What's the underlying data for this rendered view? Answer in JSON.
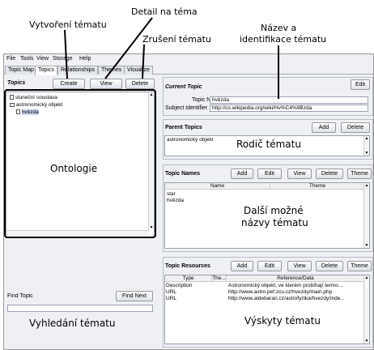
{
  "annotations": {
    "detail": "Detail na téma",
    "create": "Vytvoření tématu",
    "delete": "Zrušení tématu",
    "name_line1": "Název a",
    "name_line2": "identifikace tématu",
    "parent": "Rodič tématu",
    "ontology": "Ontologie",
    "names_line1": "Další možné",
    "names_line2": "názvy tématu",
    "find": "Vyhledání tématu",
    "resources": "Výskyty tématu"
  },
  "menu": [
    "File",
    "Tools",
    "View",
    "Storage",
    "Help"
  ],
  "tabs": [
    "Topic Map",
    "Topics",
    "Relationships",
    "Themes",
    "Visualize"
  ],
  "topics_panel": {
    "title": "Topics",
    "create": "Create",
    "view": "View",
    "delete": "Delete",
    "tree": [
      "sluneční soustava",
      "astronomický objekt",
      "hvězda"
    ]
  },
  "find": {
    "label": "Find Topic",
    "button": "Find Next",
    "value": ""
  },
  "current_topic": {
    "title": "Current Topic",
    "edit": "Edit",
    "name_label": "Topic Name",
    "name_value": "hvězda",
    "subject_label": "Subject Identifier",
    "subject_value": "http://cs.wikipedia.org/wiki/Hv%C4%9Bzda"
  },
  "parent_topics": {
    "title": "Parent Topics",
    "add": "Add",
    "delete": "Delete",
    "items": [
      "astronomický objekt"
    ]
  },
  "topic_names": {
    "title": "Topic Names",
    "buttons": [
      "Add",
      "Edit",
      "View",
      "Delete",
      "Theme"
    ],
    "columns": [
      "Name",
      "Theme"
    ],
    "rows": [
      [
        "star",
        ""
      ],
      [
        "hvězda",
        ""
      ]
    ]
  },
  "topic_resources": {
    "title": "Topic Resources",
    "buttons": [
      "Add",
      "Edit",
      "View",
      "Delete",
      "Theme"
    ],
    "columns": [
      "Type",
      "The...",
      "Reference/Data"
    ],
    "rows": [
      [
        "Description",
        "",
        "Astronomický objekt, ve kterém probíhají termo..."
      ],
      [
        "URL",
        "",
        "http://www.astro.pef.zcu.cz/hvezdy/main.php"
      ],
      [
        "URL",
        "",
        "http://www.aldebaran.cz/astrofyzika/hvezdy/inde..."
      ]
    ]
  }
}
